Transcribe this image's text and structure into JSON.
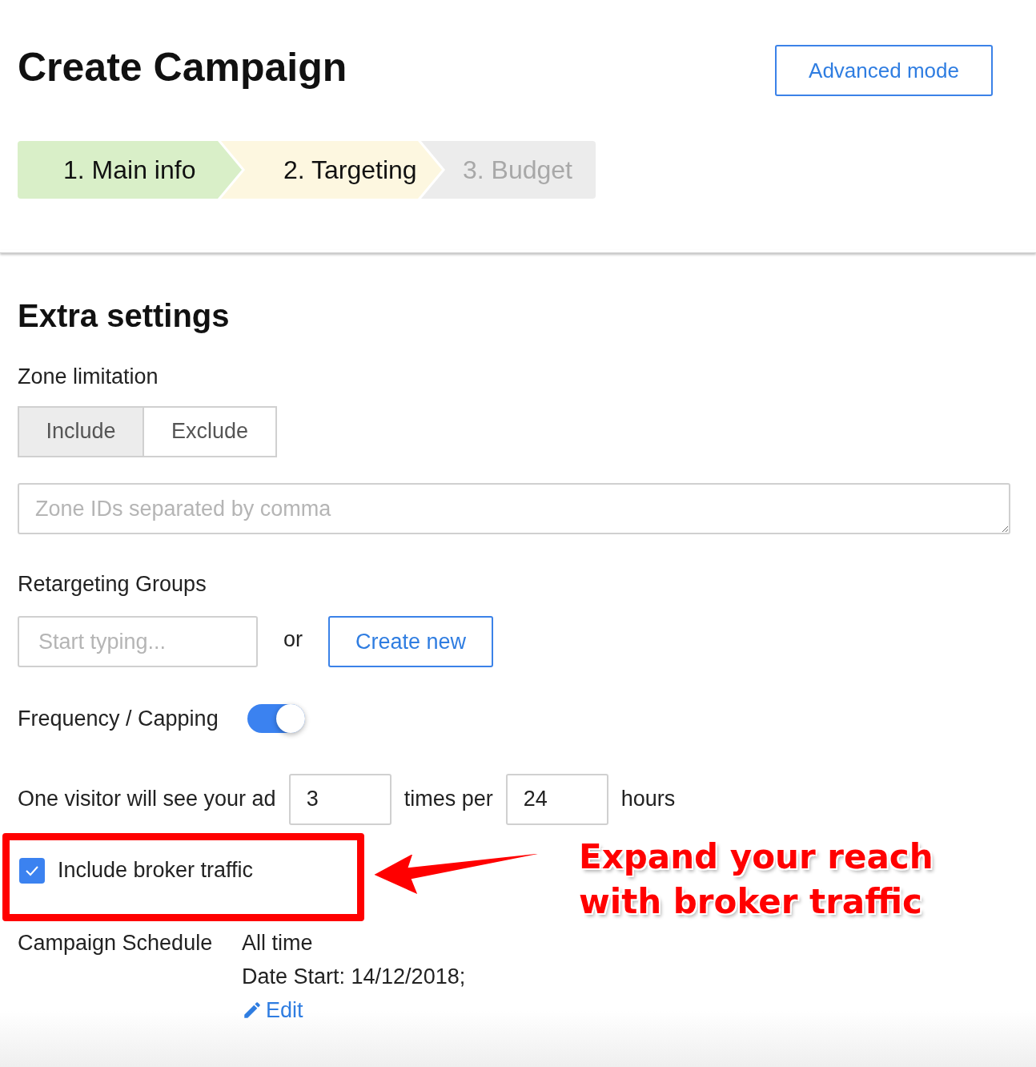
{
  "header": {
    "title": "Create Campaign",
    "advanced_button": "Advanced mode"
  },
  "steps": [
    {
      "label": "1. Main info",
      "kind": "done"
    },
    {
      "label": "2. Targeting",
      "kind": "current"
    },
    {
      "label": "3. Budget",
      "kind": "upcoming"
    }
  ],
  "section_title": "Extra settings",
  "zone_limitation": {
    "label": "Zone limitation",
    "options": [
      {
        "label": "Include",
        "selected": true
      },
      {
        "label": "Exclude",
        "selected": false
      }
    ],
    "placeholder": "Zone IDs separated by comma"
  },
  "retargeting": {
    "label": "Retargeting Groups",
    "placeholder": "Start typing...",
    "or": "or",
    "create_button": "Create new"
  },
  "frequency": {
    "label": "Frequency / Capping",
    "on": true
  },
  "capping": {
    "prefix": "One visitor will see your ad",
    "times": "3",
    "middle": "times per",
    "hours": "24",
    "suffix": "hours"
  },
  "broker": {
    "label": "Include broker traffic",
    "checked": true
  },
  "annotation": {
    "text": [
      "Expand your reach",
      "with broker traffic"
    ]
  },
  "schedule": {
    "label": "Campaign Schedule",
    "value": "All time",
    "date": "Date Start: 14/12/2018;",
    "edit": "Edit"
  }
}
